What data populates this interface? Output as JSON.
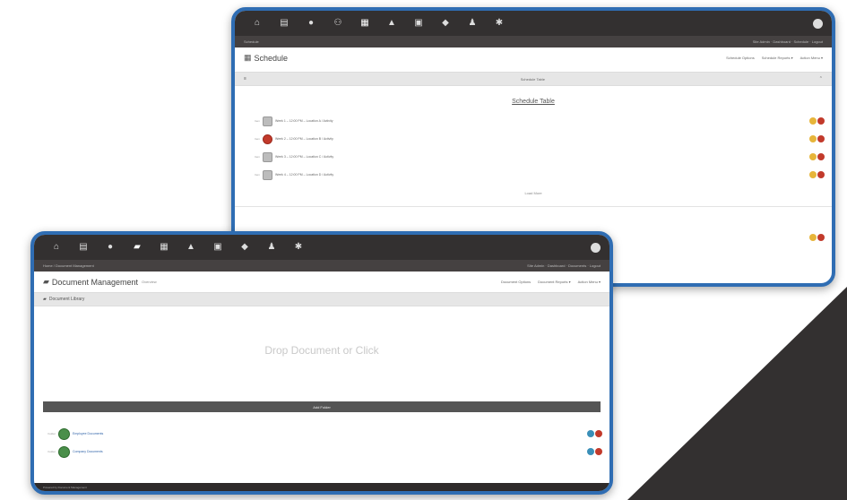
{
  "colors": {
    "frame": "#2f6db3",
    "toolbar": "#333030",
    "red": "#c23a2b",
    "green": "#4a8f4a",
    "yellow": "#e7b53a",
    "dark_decor": "#333030"
  },
  "top_window": {
    "toolbar_icons": [
      "home-icon",
      "document-icon",
      "user-icon",
      "users-icon",
      "calendar-icon",
      "warning-icon",
      "clipboard-icon",
      "tag-icon",
      "person-icon",
      "settings-icon"
    ],
    "statusbar_left": "Schedule",
    "statusbar_right": "Site Admin · Dashboard · Schedule · Logout",
    "title": "Schedule",
    "actions": [
      "Schedule Options",
      "Schedule Reports ▾",
      "Action Menu ▾"
    ],
    "panel_label": "Schedule Table",
    "section_title": "Schedule Table",
    "rows": [
      {
        "label": "Item",
        "text": "Week 1 – 12:00 PM  –  Location A / Activity",
        "red": false
      },
      {
        "label": "Item",
        "text": "Week 2 – 12:00 PM  –  Location B / Activity",
        "red": true
      },
      {
        "label": "Item",
        "text": "Week 3 – 12:00 PM  –  Location C / Activity",
        "red": false
      },
      {
        "label": "Item",
        "text": "Week 4 – 12:00 PM  –  Location D / Activity",
        "red": false
      }
    ],
    "more_label": "Load More"
  },
  "bottom_window": {
    "toolbar_icons": [
      "home-icon",
      "document-icon",
      "user-icon",
      "folder-icon",
      "calendar-icon",
      "warning-icon",
      "clipboard-icon",
      "tag-icon",
      "person-icon",
      "settings-icon"
    ],
    "statusbar_left": "Home / Document Management",
    "statusbar_right": "Site Admin · Dashboard · Documents · Logout",
    "title": "Document Management",
    "title_sub": "Overview",
    "actions": [
      "Document Options",
      "Document Reports ▾",
      "Action Menu ▾"
    ],
    "panel_label": "Document Library",
    "drop_text": "Drop Document or Click",
    "bar_label": "Add Folder",
    "rows": [
      {
        "label": "Folder",
        "text": "Employee Documents"
      },
      {
        "label": "Folder",
        "text": "Company Documents"
      }
    ],
    "footer_text": "Powered by Document Management"
  }
}
